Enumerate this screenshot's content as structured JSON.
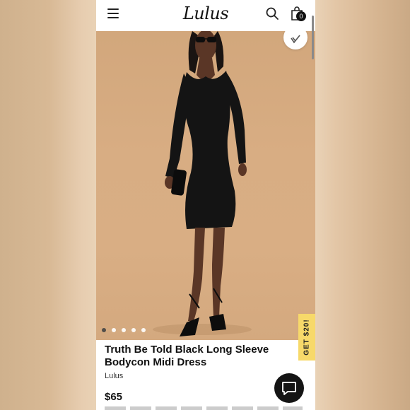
{
  "header": {
    "logo_text": "Lulus",
    "bag_count": "0",
    "icons": [
      "hamburger-menu-icon",
      "search-icon",
      "shopping-bag-icon"
    ]
  },
  "gallery": {
    "image_count": 5,
    "active_index": 0,
    "wishlist_icon": "heart-check-icon"
  },
  "promo": {
    "label": "GET $20!"
  },
  "product": {
    "title": "Truth Be Told Black Long Sleeve Bodycon Midi Dress",
    "brand": "Lulus",
    "price": "$65"
  },
  "chat": {
    "icon": "chat-bubble-icon"
  },
  "colors": {
    "backdrop": "#e9d2b6",
    "hero_bg": "#d8ad83",
    "dress": "#141414",
    "promo_bg": "#f7d96a",
    "chat_bg": "#141414"
  }
}
